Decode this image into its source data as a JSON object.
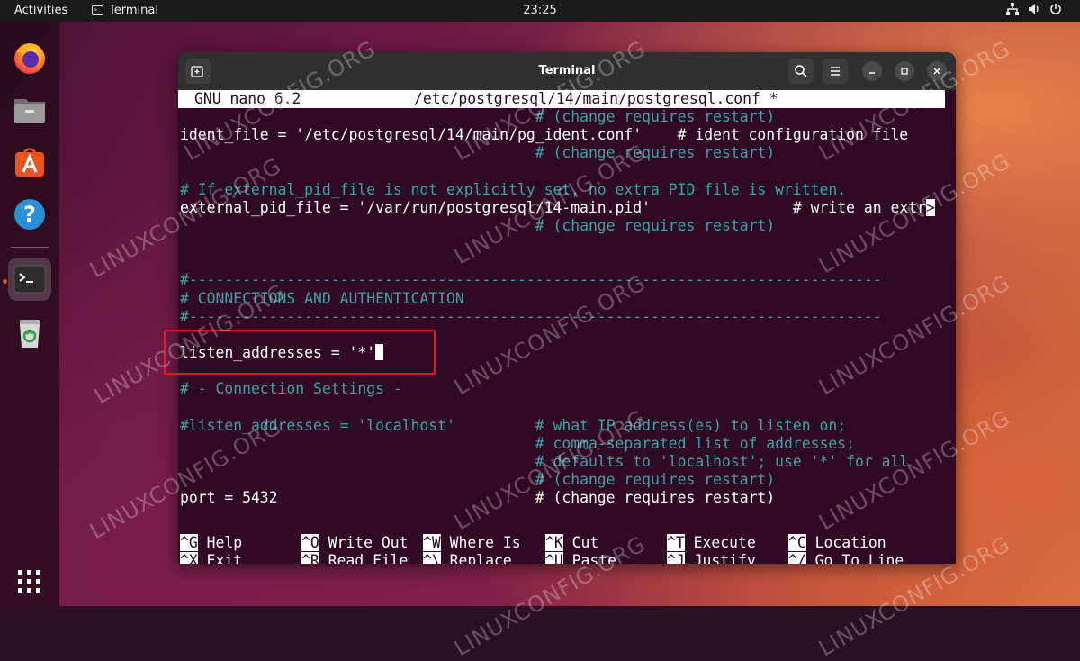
{
  "topbar": {
    "activities": "Activities",
    "app_name": "Terminal",
    "clock": "23:25"
  },
  "dock": {
    "items": [
      {
        "name": "firefox"
      },
      {
        "name": "files"
      },
      {
        "name": "app-center"
      },
      {
        "name": "help"
      },
      {
        "name": "terminal"
      },
      {
        "name": "trash"
      }
    ]
  },
  "window": {
    "title": "Terminal"
  },
  "nano": {
    "header_left": "GNU nano 6.2",
    "header_file": "/etc/postgresql/14/main/postgresql.conf *",
    "lines": [
      {
        "indent": "                                        ",
        "text": "# (change requires restart)",
        "type": "comment"
      },
      {
        "code": "ident_file = '/etc/postgresql/14/main/pg_ident.conf'    ",
        "text": "# ident configuration file",
        "type": "code_comment_white"
      },
      {
        "indent": "                                        ",
        "text": "# (change requires restart)",
        "type": "comment"
      },
      {
        "indent": "",
        "text": "",
        "type": "blank"
      },
      {
        "indent": "",
        "text": "# If external_pid_file is not explicitly set, no extra PID file is written.",
        "type": "comment"
      },
      {
        "code": "external_pid_file = '/var/run/postgresql/14-main.pid'                ",
        "text": "# write an extr",
        "type": "code_comment_white",
        "overflow": ">"
      },
      {
        "indent": "                                        ",
        "text": "# (change requires restart)",
        "type": "comment"
      },
      {
        "indent": "",
        "text": "",
        "type": "blank"
      },
      {
        "indent": "",
        "text": "",
        "type": "blank"
      },
      {
        "indent": "",
        "text": "#------------------------------------------------------------------------------",
        "type": "comment"
      },
      {
        "indent": "",
        "text": "# CONNECTIONS AND AUTHENTICATION",
        "type": "comment"
      },
      {
        "indent": "",
        "text": "#------------------------------------------------------------------------------",
        "type": "comment"
      },
      {
        "indent": "",
        "text": "",
        "type": "blank"
      },
      {
        "code": "listen_addresses = '*'",
        "text": "",
        "type": "code",
        "cursor": true
      },
      {
        "indent": "",
        "text": "",
        "type": "blank"
      },
      {
        "indent": "",
        "text": "# - Connection Settings -",
        "type": "comment"
      },
      {
        "indent": "",
        "text": "",
        "type": "blank"
      },
      {
        "indent": "",
        "text": "#listen_addresses = 'localhost'         # what IP address(es) to listen on;",
        "type": "comment"
      },
      {
        "indent": "                                        ",
        "text": "# comma-separated list of addresses;",
        "type": "comment"
      },
      {
        "indent": "                                        ",
        "text": "# defaults to 'localhost'; use '*' for all",
        "type": "comment"
      },
      {
        "indent": "                                        ",
        "text": "# (change requires restart)",
        "type": "comment"
      },
      {
        "code": "port = 5432                             ",
        "text": "# (change requires restart)",
        "type": "code_comment_white"
      }
    ],
    "shortcuts_row1": [
      {
        "key": "^G",
        "label": "Help"
      },
      {
        "key": "^O",
        "label": "Write Out"
      },
      {
        "key": "^W",
        "label": "Where Is"
      },
      {
        "key": "^K",
        "label": "Cut"
      },
      {
        "key": "^T",
        "label": "Execute"
      },
      {
        "key": "^C",
        "label": "Location"
      }
    ],
    "shortcuts_row2": [
      {
        "key": "^X",
        "label": "Exit"
      },
      {
        "key": "^R",
        "label": "Read File"
      },
      {
        "key": "^\\",
        "label": "Replace"
      },
      {
        "key": "^U",
        "label": "Paste"
      },
      {
        "key": "^J",
        "label": "Justify"
      },
      {
        "key": "^/",
        "label": "Go To Line"
      }
    ]
  },
  "watermark": "LINUXCONFIG.ORG",
  "colors": {
    "terminal_bg": "#300a24",
    "comment": "#3ea3a3",
    "highlight": "#e8172b",
    "ubuntu_orange": "#e95420"
  }
}
